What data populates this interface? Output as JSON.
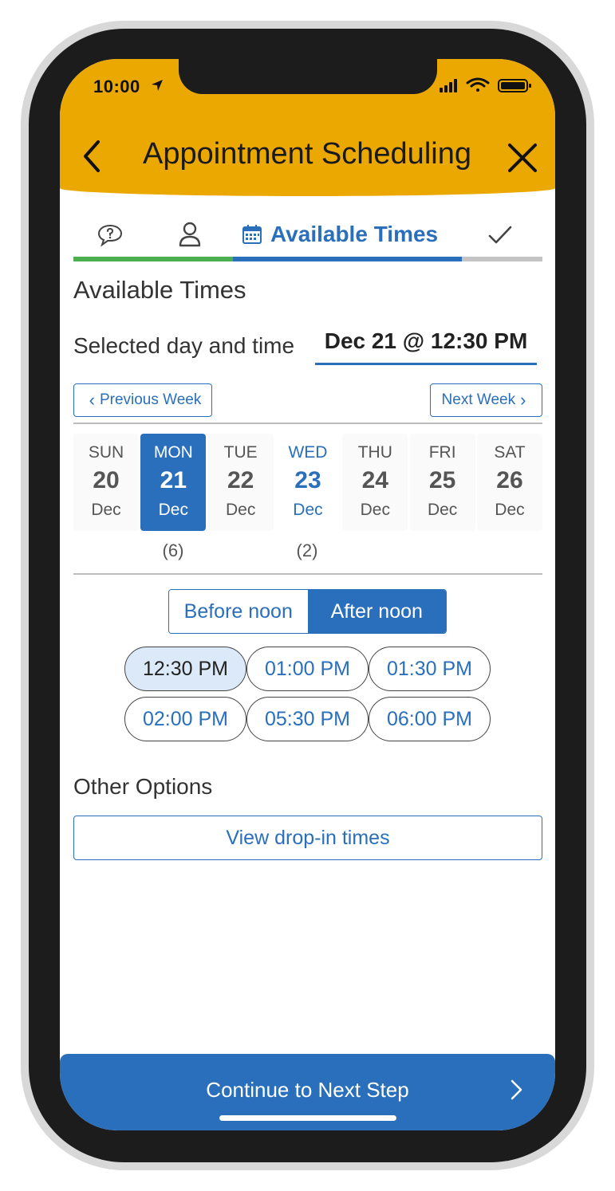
{
  "status_bar": {
    "time": "10:00"
  },
  "nav": {
    "title": "Appointment Scheduling"
  },
  "steps": {
    "active_label": "Available Times"
  },
  "page": {
    "section_title": "Available Times",
    "selected_label": "Selected day and time",
    "selected_value": "Dec 21 @ 12:30 PM"
  },
  "week_nav": {
    "previous": "Previous Week",
    "next": "Next Week"
  },
  "days": [
    {
      "dow": "SUN",
      "num": "20",
      "mon": "Dec",
      "count": ""
    },
    {
      "dow": "MON",
      "num": "21",
      "mon": "Dec",
      "count": "(6)"
    },
    {
      "dow": "TUE",
      "num": "22",
      "mon": "Dec",
      "count": ""
    },
    {
      "dow": "WED",
      "num": "23",
      "mon": "Dec",
      "count": "(2)"
    },
    {
      "dow": "THU",
      "num": "24",
      "mon": "Dec",
      "count": ""
    },
    {
      "dow": "FRI",
      "num": "25",
      "mon": "Dec",
      "count": ""
    },
    {
      "dow": "SAT",
      "num": "26",
      "mon": "Dec",
      "count": ""
    }
  ],
  "period": {
    "before": "Before noon",
    "after": "After noon",
    "selected": "after"
  },
  "slots": [
    "12:30 PM",
    "01:00 PM",
    "01:30 PM",
    "02:00 PM",
    "05:30 PM",
    "06:00 PM"
  ],
  "selected_slot": "12:30 PM",
  "other_options": {
    "title": "Other Options",
    "dropin_label": "View drop-in times"
  },
  "footer": {
    "continue_label": "Continue to Next Step"
  },
  "colors": {
    "header": "#eba800",
    "accent": "#2a6fbb",
    "progress_done": "#4caf50",
    "progress_pending": "#c4c4c4",
    "slot_selected_bg": "#dce9f8"
  },
  "icons": {
    "step1": "chat-bubble-question-icon",
    "step2": "person-icon",
    "step3": "calendar-icon",
    "step4": "checkmark-icon"
  }
}
